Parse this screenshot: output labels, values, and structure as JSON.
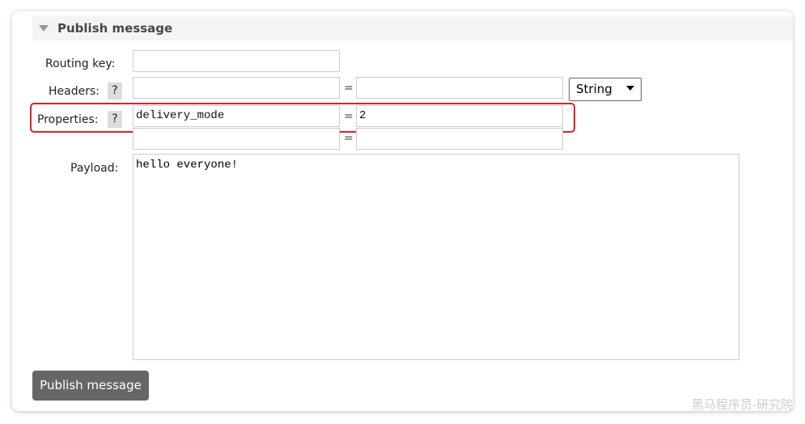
{
  "section": {
    "title": "Publish message"
  },
  "form": {
    "routing_key_label": "Routing key:",
    "routing_key_value": "",
    "headers_label": "Headers:",
    "help": "?",
    "equals": "=",
    "headers_type": "String",
    "properties_label": "Properties:",
    "properties": [
      {
        "key": "delivery_mode",
        "value": "2"
      },
      {
        "key": "",
        "value": ""
      }
    ],
    "payload_label": "Payload:",
    "payload_value": "hello everyone!"
  },
  "publish_button": "Publish message",
  "watermark": "黑马程序员-研究院",
  "colors": {
    "highlight": "#e0202a",
    "button": "#666666"
  }
}
